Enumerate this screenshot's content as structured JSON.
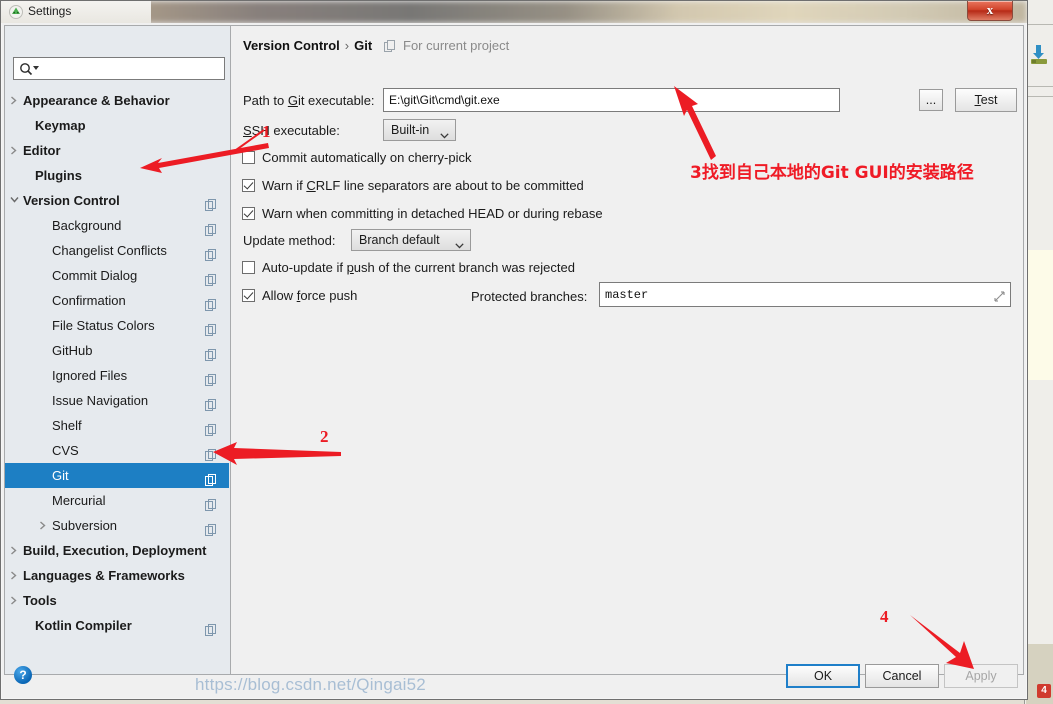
{
  "window": {
    "title": "Settings",
    "icon": "android-studio-icon",
    "close_label": "x"
  },
  "search": {
    "placeholder": "",
    "value": "",
    "icon": "search-icon"
  },
  "sidebar": {
    "items": [
      {
        "label": "Appearance & Behavior",
        "indent": 18,
        "bold": true,
        "arrow": "right",
        "copy": false,
        "selected": false
      },
      {
        "label": "Keymap",
        "indent": 30,
        "bold": true,
        "arrow": "none",
        "copy": false,
        "selected": false
      },
      {
        "label": "Editor",
        "indent": 18,
        "bold": true,
        "arrow": "right",
        "copy": false,
        "selected": false
      },
      {
        "label": "Plugins",
        "indent": 30,
        "bold": true,
        "arrow": "none",
        "copy": false,
        "selected": false
      },
      {
        "label": "Version Control",
        "indent": 18,
        "bold": true,
        "arrow": "down",
        "copy": true,
        "selected": false
      },
      {
        "label": "Background",
        "indent": 47,
        "bold": false,
        "arrow": "none",
        "copy": true,
        "selected": false
      },
      {
        "label": "Changelist Conflicts",
        "indent": 47,
        "bold": false,
        "arrow": "none",
        "copy": true,
        "selected": false
      },
      {
        "label": "Commit Dialog",
        "indent": 47,
        "bold": false,
        "arrow": "none",
        "copy": true,
        "selected": false
      },
      {
        "label": "Confirmation",
        "indent": 47,
        "bold": false,
        "arrow": "none",
        "copy": true,
        "selected": false
      },
      {
        "label": "File Status Colors",
        "indent": 47,
        "bold": false,
        "arrow": "none",
        "copy": true,
        "selected": false
      },
      {
        "label": "GitHub",
        "indent": 47,
        "bold": false,
        "arrow": "none",
        "copy": true,
        "selected": false
      },
      {
        "label": "Ignored Files",
        "indent": 47,
        "bold": false,
        "arrow": "none",
        "copy": true,
        "selected": false
      },
      {
        "label": "Issue Navigation",
        "indent": 47,
        "bold": false,
        "arrow": "none",
        "copy": true,
        "selected": false
      },
      {
        "label": "Shelf",
        "indent": 47,
        "bold": false,
        "arrow": "none",
        "copy": true,
        "selected": false
      },
      {
        "label": "CVS",
        "indent": 47,
        "bold": false,
        "arrow": "none",
        "copy": true,
        "selected": false
      },
      {
        "label": "Git",
        "indent": 47,
        "bold": false,
        "arrow": "none",
        "copy": true,
        "selected": true
      },
      {
        "label": "Mercurial",
        "indent": 47,
        "bold": false,
        "arrow": "none",
        "copy": true,
        "selected": false
      },
      {
        "label": "Subversion",
        "indent": 47,
        "bold": false,
        "arrow": "right",
        "copy": true,
        "selected": false
      },
      {
        "label": "Build, Execution, Deployment",
        "indent": 18,
        "bold": true,
        "arrow": "right",
        "copy": false,
        "selected": false
      },
      {
        "label": "Languages & Frameworks",
        "indent": 18,
        "bold": true,
        "arrow": "right",
        "copy": false,
        "selected": false
      },
      {
        "label": "Tools",
        "indent": 18,
        "bold": true,
        "arrow": "right",
        "copy": false,
        "selected": false
      },
      {
        "label": "Kotlin Compiler",
        "indent": 30,
        "bold": true,
        "arrow": "none",
        "copy": true,
        "selected": false
      }
    ]
  },
  "main": {
    "breadcrumb_parent": "Version Control",
    "breadcrumb_sep": "›",
    "breadcrumb_current": "Git",
    "for_current_project": "For current project",
    "path_label_pre": "Path to ",
    "path_label_key": "G",
    "path_label_post": "it executable:",
    "path_value": "E:\\git\\Git\\cmd\\git.exe",
    "browse_label": "...",
    "test_key": "T",
    "test_rest": "est",
    "ssh_label_key": "S",
    "ssh_label_rest": "SH executable:",
    "ssh_value": "Built-in",
    "checkbox_cherry_pre": "C",
    "checkbox_cherry_post": "ommit automatically on cherry-pick",
    "checkbox_cherry_checked": false,
    "checkbox_crlf_pre": "Warn if ",
    "checkbox_crlf_key": "C",
    "checkbox_crlf_post": "RLF line separators are about to be committed",
    "checkbox_crlf_checked": true,
    "checkbox_detached": "Warn when committing in detached HEAD or during rebase",
    "checkbox_detached_checked": true,
    "update_method_label": "Update method:",
    "update_method_value": "Branch default",
    "checkbox_autoupdate_pre": "Auto-update if ",
    "checkbox_autoupdate_key": "p",
    "checkbox_autoupdate_post": "ush of the current branch was rejected",
    "checkbox_autoupdate_checked": false,
    "checkbox_force_pre": "Allow ",
    "checkbox_force_key": "f",
    "checkbox_force_post": "orce push",
    "checkbox_force_checked": true,
    "protected_label": "Protected branches:",
    "protected_value": "master"
  },
  "buttons": {
    "ok": "OK",
    "cancel": "Cancel",
    "apply": "Apply",
    "help": "?"
  },
  "annotations": {
    "num1": "1",
    "num2": "2",
    "num3_text": "3找到自己本地的Git GUI的安装路径",
    "num4": "4"
  },
  "watermark": {
    "text": "https://blog.csdn.net/Qingai52"
  },
  "colors": {
    "selection": "#1d7fc4",
    "annotation_red": "#ec1c24",
    "sidebar_bg": "#e6eaee",
    "panel_bg": "#f0f0f0"
  }
}
